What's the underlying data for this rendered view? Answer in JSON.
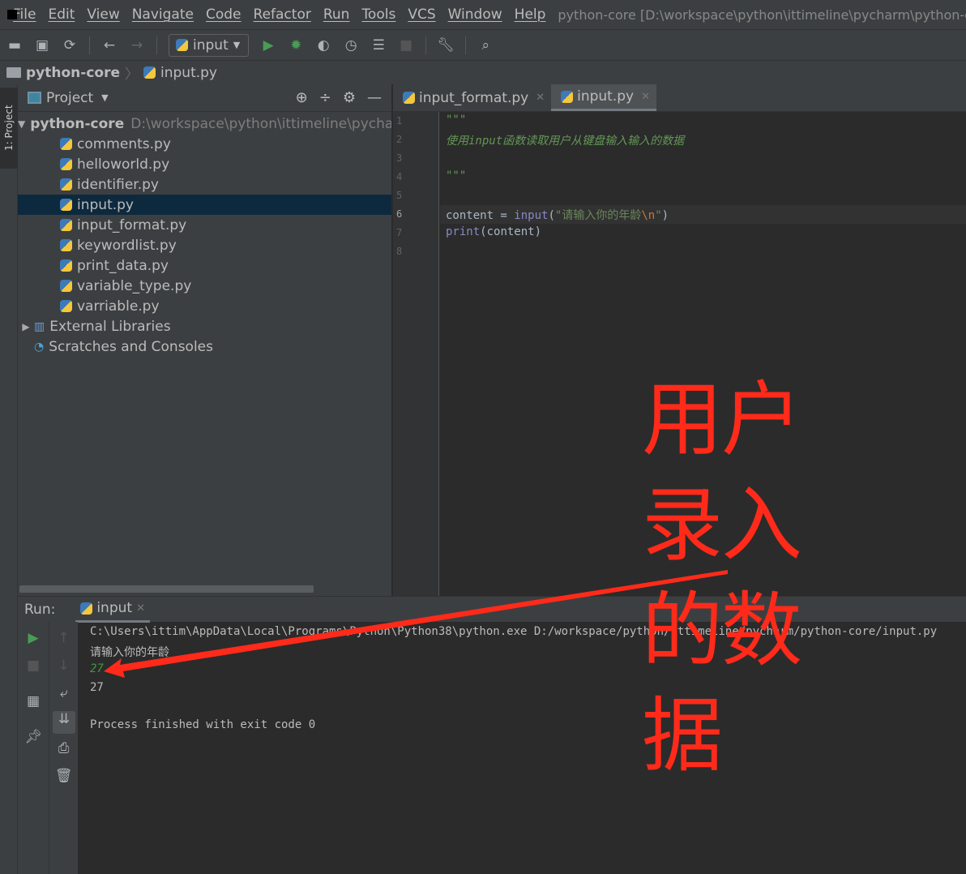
{
  "menu": {
    "items": [
      "File",
      "Edit",
      "View",
      "Navigate",
      "Code",
      "Refactor",
      "Run",
      "Tools",
      "VCS",
      "Window",
      "Help"
    ],
    "title": "python-core [D:\\workspace\\python\\ittimeline\\pycharm\\python-core]"
  },
  "toolbar": {
    "run_config": "input"
  },
  "breadcrumb": {
    "project": "python-core",
    "file": "input.py"
  },
  "sidebar": {
    "tab": "1: Project"
  },
  "project": {
    "header": "Project",
    "root": "python-core",
    "root_path": "D:\\workspace\\python\\ittimeline\\pycharm",
    "files": [
      "comments.py",
      "helloworld.py",
      "identifier.py",
      "input.py",
      "input_format.py",
      "keywordlist.py",
      "print_data.py",
      "variable_type.py",
      "varriable.py"
    ],
    "selected": "input.py",
    "external": "External Libraries",
    "scratches": "Scratches and Consoles"
  },
  "editor": {
    "tabs": [
      {
        "label": "input_format.py"
      },
      {
        "label": "input.py",
        "active": true
      }
    ],
    "lines": [
      "1",
      "2",
      "3",
      "4",
      "5",
      "6",
      "7",
      "8"
    ],
    "code": {
      "l1": "\"\"\"",
      "l2": "使用input函数读取用户从键盘输入输入的数据",
      "l4": "\"\"\"",
      "l6a": "content = ",
      "l6b": "input",
      "l6c": "(",
      "l6d": "\"请输入你的年龄",
      "l6e": "\\n",
      "l6f": "\"",
      "l6g": ")",
      "l7a": "print",
      "l7b": "(content)"
    }
  },
  "run": {
    "label": "Run:",
    "tab": "input",
    "console": [
      "C:\\Users\\ittim\\AppData\\Local\\Programs\\Python\\Python38\\python.exe D:/workspace/python/ittimeline/pycharm/python-core/input.py",
      "请输入你的年龄",
      "27",
      "27",
      "Process finished with exit code 0"
    ]
  },
  "annotation": {
    "lines": [
      "用户",
      "录入",
      "的数",
      "据"
    ],
    "color": "#ff2a1a"
  }
}
